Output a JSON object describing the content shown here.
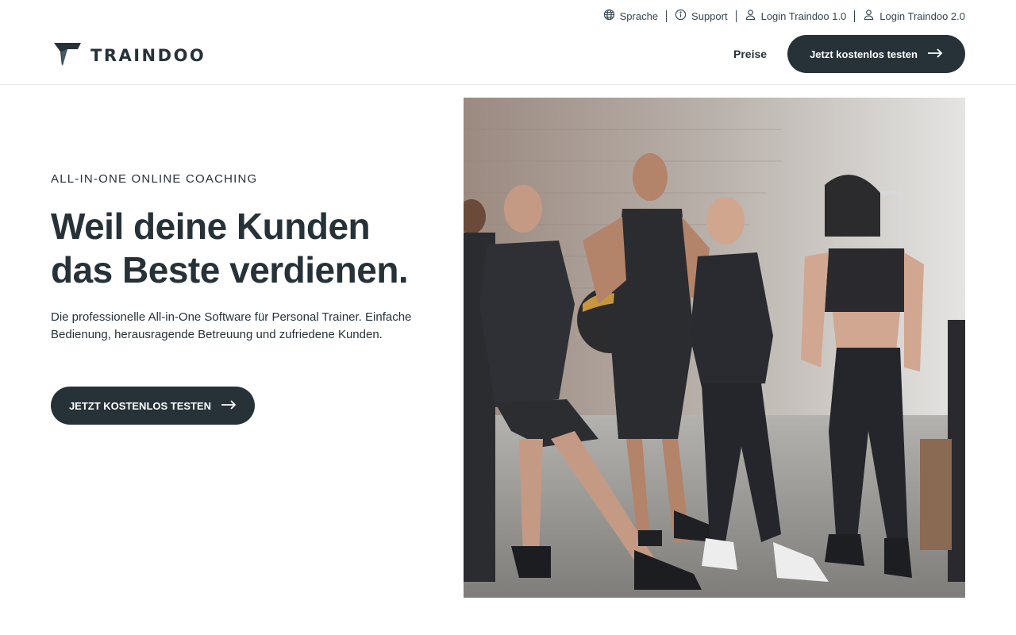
{
  "utility": {
    "language_label": "Sprache",
    "support_label": "Support",
    "login1_label": "Login Traindoo 1.0",
    "login2_label": "Login Traindoo 2.0"
  },
  "header": {
    "logo_text": "TRAINDOO",
    "nav_prices": "Preise",
    "cta_label": "Jetzt kostenlos testen"
  },
  "hero": {
    "eyebrow": "ALL-IN-ONE ONLINE COACHING",
    "headline_line1": "Weil deine Kunden",
    "headline_line2": "das Beste verdienen.",
    "subtext": "Die professionelle All-in-One Software für Personal Trainer. Einfache Bedienung, herausragende Betreuung und zufriedene Kunden.",
    "cta_label": "JETZT KOSTENLOS TESTEN"
  },
  "colors": {
    "primary": "#263238",
    "text": "#263238",
    "background": "#ffffff"
  },
  "icons": {
    "language": "globe-icon",
    "support": "info-icon",
    "login": "user-icon",
    "cta": "arrow-right-icon"
  }
}
